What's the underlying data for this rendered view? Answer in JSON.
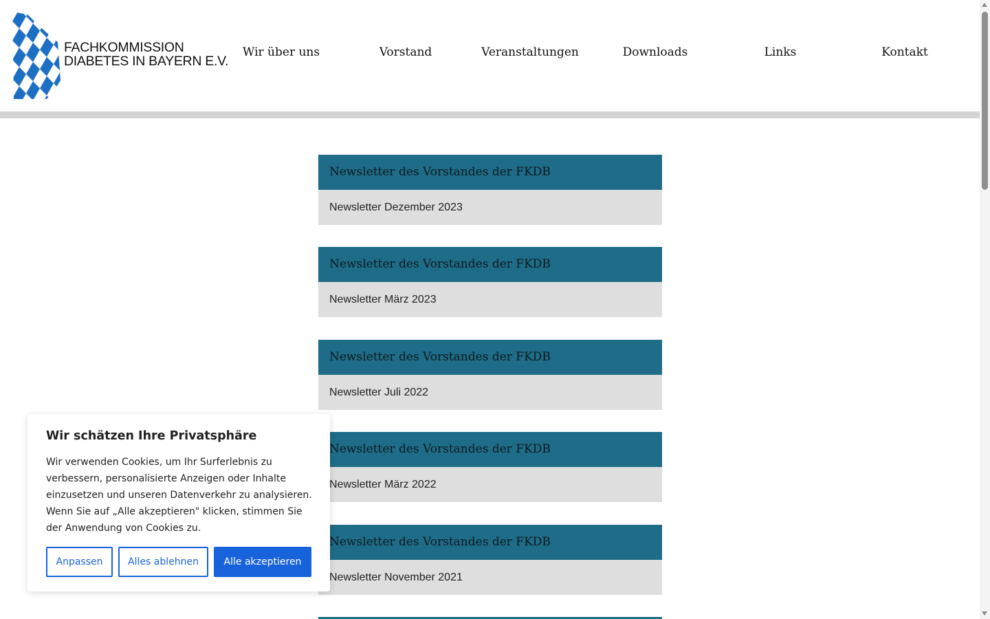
{
  "logo": {
    "line1": "FACHKOMMISSION",
    "line2": "DIABETES IN BAYERN E.V.",
    "pattern_colors": [
      "#1d6fc4",
      "#ffffff"
    ]
  },
  "nav": {
    "items": [
      {
        "label": "Wir über uns"
      },
      {
        "label": "Vorstand"
      },
      {
        "label": "Veranstaltungen"
      },
      {
        "label": "Downloads"
      },
      {
        "label": "Links"
      },
      {
        "label": "Kontakt"
      }
    ]
  },
  "newsletters": [
    {
      "heading": "Newsletter des Vorstandes der FKDB",
      "title": "Newsletter Dezember 2023"
    },
    {
      "heading": "Newsletter des Vorstandes der FKDB",
      "title": "Newsletter März 2023"
    },
    {
      "heading": "Newsletter des Vorstandes der FKDB",
      "title": "Newsletter Juli 2022"
    },
    {
      "heading": "Newsletter des Vorstandes der FKDB",
      "title": "Newsletter März 2022"
    },
    {
      "heading": "Newsletter des Vorstandes der FKDB",
      "title": "Newsletter November 2021"
    }
  ],
  "cookie": {
    "title": "Wir schätzen Ihre Privatsphäre",
    "text": "Wir verwenden Cookies, um Ihr Surferlebnis zu verbessern, personalisierte Anzeigen oder Inhalte einzusetzen und unseren Datenverkehr zu analysieren. Wenn Sie auf „Alle akzeptieren\" klicken, stimmen Sie der Anwendung von Cookies zu.",
    "customize_label": "Anpassen",
    "reject_label": "Alles ablehnen",
    "accept_label": "Alle akzeptieren"
  },
  "colors": {
    "card_header": "#1e6c87",
    "card_body": "#dedede",
    "accent": "#1863dc"
  }
}
